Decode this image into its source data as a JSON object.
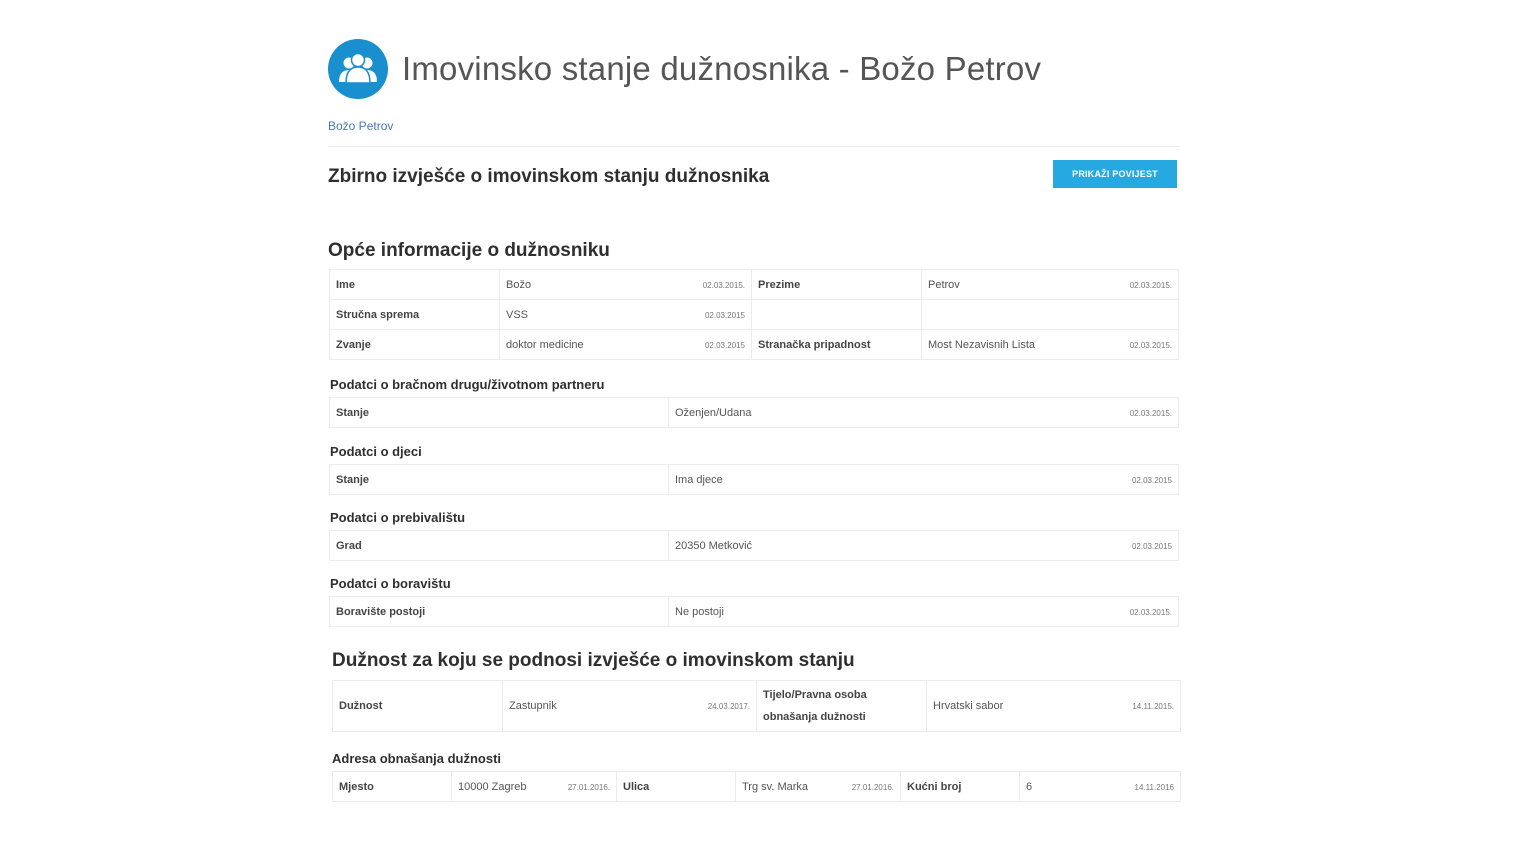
{
  "header": {
    "title": "Imovinsko stanje dužnosnika - Božo Petrov",
    "logo_icon": "users-icon",
    "accent": "#1a8fd0"
  },
  "breadcrumb": "Božo Petrov",
  "report": {
    "title": "Zbirno izvješće o imovinskom stanju dužnosnika",
    "button_label": "PRIKAŽI POVIJEST",
    "button_color": "#26a9e0"
  },
  "general": {
    "title": "Opće informacije o dužnosniku",
    "rows": [
      {
        "label1": "Ime",
        "value1": "Božo",
        "date1": "02.03.2015.",
        "label2": "Prezime",
        "value2": "Petrov",
        "date2": "02.03.2015."
      },
      {
        "label1": "Stručna sprema",
        "value1": "VSS",
        "date1": "02.03.2015",
        "label2": "",
        "value2": "",
        "date2": ""
      },
      {
        "label1": "Zvanje",
        "value1": "doktor medicine",
        "date1": "02.03.2015",
        "label2": "Stranačka pripadnost",
        "value2": "Most Nezavisnih Lista",
        "date2": "02.03.2015."
      }
    ]
  },
  "spouse": {
    "title": "Podatci o bračnom drugu/životnom partneru",
    "label": "Stanje",
    "value": "Oženjen/Udana",
    "date": "02.03.2015."
  },
  "children": {
    "title": "Podatci o djeci",
    "label": "Stanje",
    "value": "Ima djece",
    "date": "02.03.2015"
  },
  "residence": {
    "title": "Podatci o prebivalištu",
    "label": "Grad",
    "value": "20350 Metković",
    "date": "02.03.2015"
  },
  "stay": {
    "title": "Podatci o boravištu",
    "label": "Boravište postoji",
    "value": "Ne postoji",
    "date": "02.03.2015."
  },
  "duty": {
    "title": "Dužnost za koju se podnosi izvješće o imovinskom stanju",
    "label1": "Dužnost",
    "value1": "Zastupnik",
    "date1": "24.03.2017.",
    "label2_line1": "Tijelo/Pravna osoba",
    "label2_line2": "obnašanja dužnosti",
    "value2": "Hrvatski sabor",
    "date2": "14.11.2015."
  },
  "address": {
    "title": "Adresa obnašanja dužnosti",
    "label1": "Mjesto",
    "value1": "10000 Zagreb",
    "date1": "27.01.2016.",
    "label2": "Ulica",
    "value2": "Trg sv. Marka",
    "date2": "27.01.2016.",
    "label3": "Kućni broj",
    "value3": "6",
    "date3": "14.11.2016"
  }
}
